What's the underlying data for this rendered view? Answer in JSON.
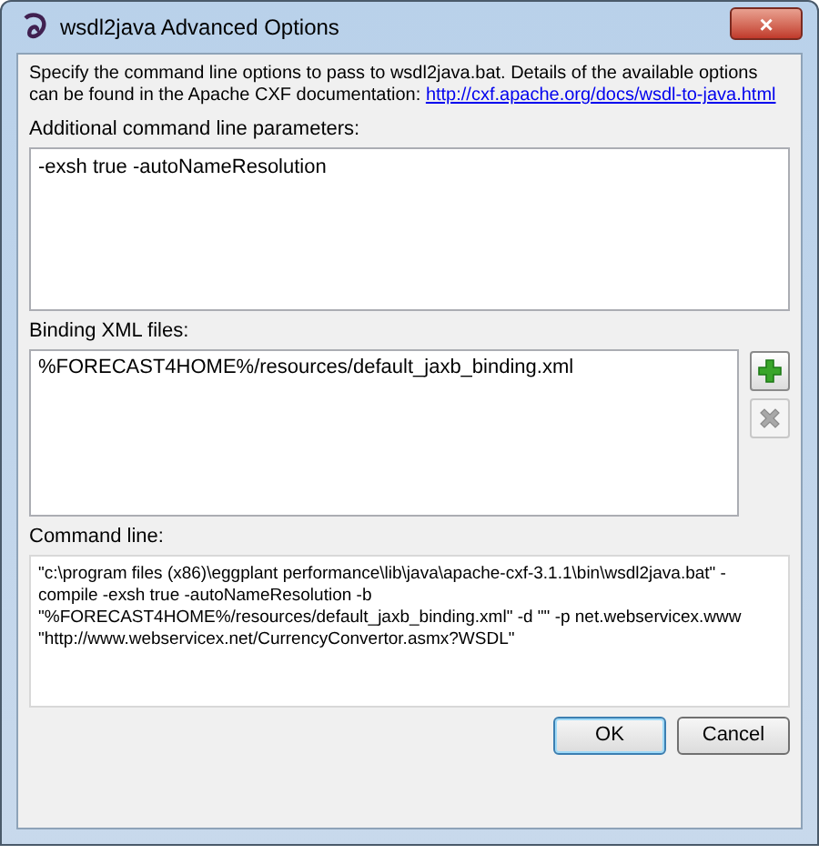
{
  "window": {
    "title": "wsdl2java Advanced Options",
    "close_button": "×"
  },
  "description": {
    "text": "Specify the command line options to pass to wsdl2java.bat. Details of the available options can be found in the Apache CXF documentation:",
    "link": "http://cxf.apache.org/docs/wsdl-to-java.html"
  },
  "parameters": {
    "label": "Additional command line parameters:",
    "value": "-exsh true -autoNameResolution"
  },
  "bindings": {
    "label": "Binding XML files:",
    "items": [
      {
        "text": "%FORECAST4HOME%/resources/default_jaxb_binding.xml",
        "selected": false
      }
    ],
    "add_disabled": false,
    "remove_disabled": true
  },
  "command_line": {
    "label": "Command line:",
    "value": "\"c:\\program files (x86)\\eggplant performance\\lib\\java\\apache-cxf-3.1.1\\bin\\wsdl2java.bat\" -compile -exsh true -autoNameResolution -b \"%FORECAST4HOME%/resources/default_jaxb_binding.xml\" -d \"\" -p net.webservicex.www \"http://www.webservicex.net/CurrencyConvertor.asmx?WSDL\""
  },
  "buttons": [
    {
      "label": "OK",
      "default": true
    },
    {
      "label": "Cancel",
      "default": false
    }
  ]
}
